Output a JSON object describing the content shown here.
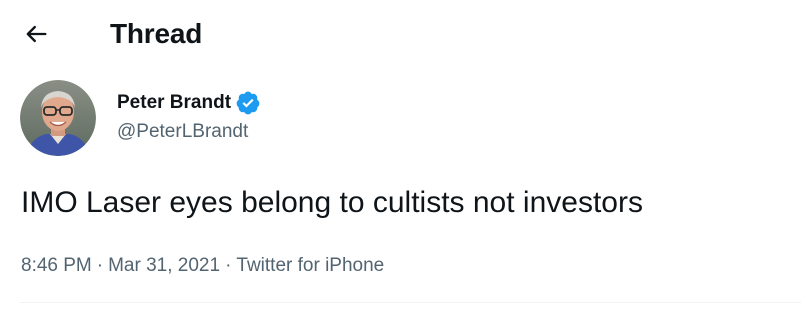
{
  "header": {
    "back_icon": "arrow-left-icon",
    "title": "Thread"
  },
  "tweet": {
    "author": {
      "display_name": "Peter Brandt",
      "handle": "@PeterLBrandt",
      "verified": true,
      "verified_icon": "verified-badge-icon",
      "verified_color": "#1d9bf0"
    },
    "text": "IMO Laser eyes belong to cultists not investors",
    "time": "8:46 PM",
    "date": "Mar 31, 2021",
    "source": "Twitter for iPhone",
    "separator": "·"
  },
  "colors": {
    "text_primary": "#0f1419",
    "text_secondary": "#536471",
    "divider": "#eff3f4",
    "background": "#ffffff"
  }
}
